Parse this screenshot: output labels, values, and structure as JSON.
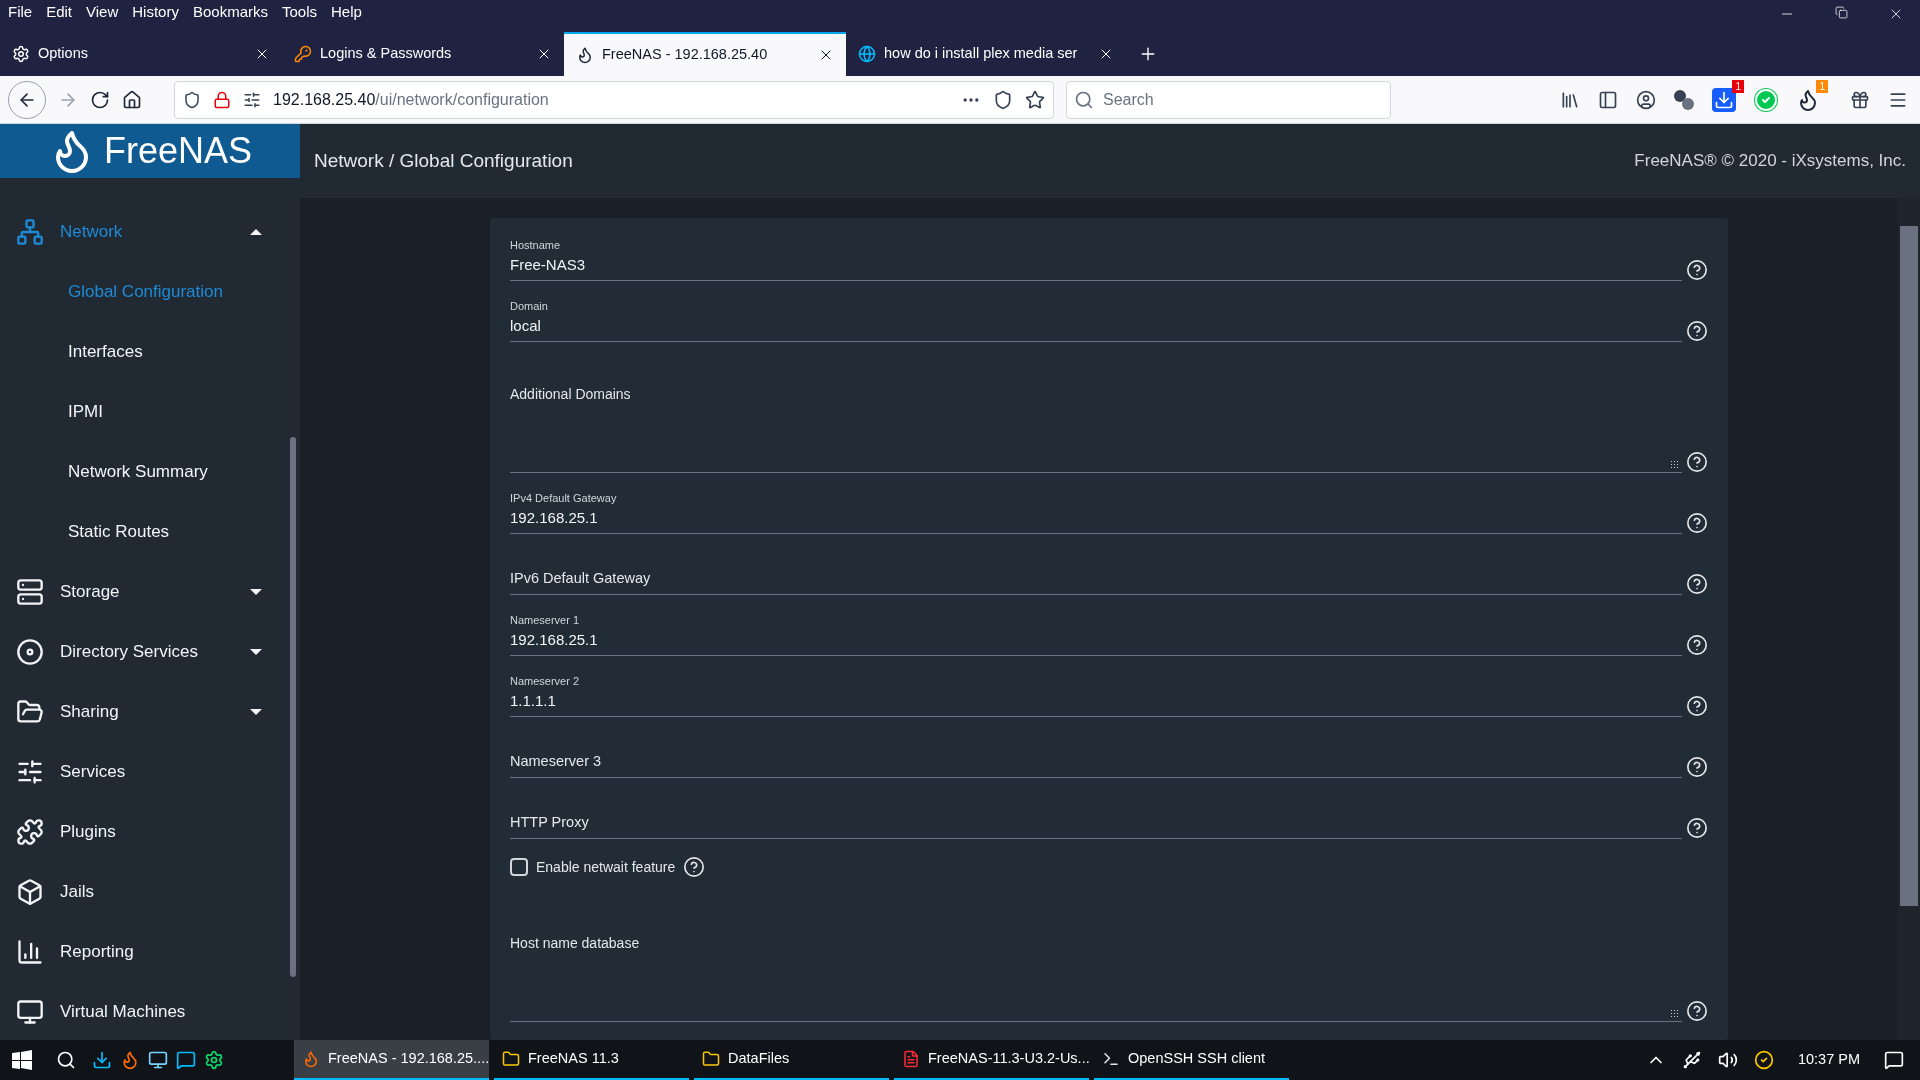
{
  "menu_bar": [
    "File",
    "Edit",
    "View",
    "History",
    "Bookmarks",
    "Tools",
    "Help"
  ],
  "tabs": [
    {
      "label": "Options",
      "kind": "settings",
      "selected": false
    },
    {
      "label": "Logins & Passwords",
      "kind": "logins",
      "selected": false
    },
    {
      "label": "FreeNAS - 192.168.25.40",
      "kind": "freenas",
      "selected": true
    },
    {
      "label": "how do i install plex media ser",
      "kind": "ix",
      "selected": false
    }
  ],
  "address": {
    "host": "192.168.25.40",
    "path": "/ui/network/configuration"
  },
  "search": {
    "placeholder": "Search"
  },
  "toolbar_badges": [
    "1",
    "1"
  ],
  "app": {
    "logo": "FreeNAS",
    "breadcrumb": "Network  /  Global Configuration",
    "copyright": "FreeNAS® © 2020 - iXsystems, Inc."
  },
  "sidebar": [
    {
      "label": "Network",
      "kind": "network",
      "selected": true,
      "expanded": true,
      "children": [
        {
          "label": "Global Configuration",
          "selected": true
        },
        {
          "label": "Interfaces",
          "selected": false
        },
        {
          "label": "IPMI",
          "selected": false
        },
        {
          "label": "Network Summary",
          "selected": false
        },
        {
          "label": "Static Routes",
          "selected": false
        }
      ]
    },
    {
      "label": "Storage",
      "kind": "storage",
      "selected": false,
      "expanded": false
    },
    {
      "label": "Directory Services",
      "kind": "directory",
      "selected": false,
      "expanded": false
    },
    {
      "label": "Sharing",
      "kind": "sharing",
      "selected": false,
      "expanded": false
    },
    {
      "label": "Services",
      "kind": "services",
      "selected": false
    },
    {
      "label": "Plugins",
      "kind": "plugins",
      "selected": false
    },
    {
      "label": "Jails",
      "kind": "jails",
      "selected": false
    },
    {
      "label": "Reporting",
      "kind": "reporting",
      "selected": false
    },
    {
      "label": "Virtual Machines",
      "kind": "vm",
      "selected": false
    }
  ],
  "form": [
    {
      "kind": "text",
      "label": "Hostname",
      "value": "Free-NAS3"
    },
    {
      "kind": "text",
      "label": "Domain",
      "value": "local"
    },
    {
      "kind": "textarea",
      "label": "Additional Domains"
    },
    {
      "kind": "text",
      "label": "IPv4 Default Gateway",
      "value": "192.168.25.1"
    },
    {
      "kind": "text",
      "label": "IPv6 Default Gateway"
    },
    {
      "kind": "text",
      "label": "Nameserver 1",
      "value": "192.168.25.1"
    },
    {
      "kind": "text",
      "label": "Nameserver 2",
      "value": "1.1.1.1"
    },
    {
      "kind": "text",
      "label": "Nameserver 3"
    },
    {
      "kind": "text",
      "label": "HTTP Proxy"
    },
    {
      "kind": "checkbox",
      "label": "Enable netwait feature",
      "checked": false
    },
    {
      "kind": "textarea",
      "label": "Host name database"
    }
  ],
  "taskbar": [
    {
      "label": "FreeNAS - 192.168.25....",
      "kind": "firefox",
      "selected": true
    },
    {
      "label": "FreeNAS 11.3",
      "kind": "folder",
      "selected": false
    },
    {
      "label": "DataFiles",
      "kind": "folder",
      "selected": false
    },
    {
      "label": "FreeNAS-11.3-U3.2-Us...",
      "kind": "pdf",
      "selected": false
    },
    {
      "label": "OpenSSH SSH client",
      "kind": "terminal",
      "selected": false
    }
  ],
  "clock": "10:37 PM"
}
